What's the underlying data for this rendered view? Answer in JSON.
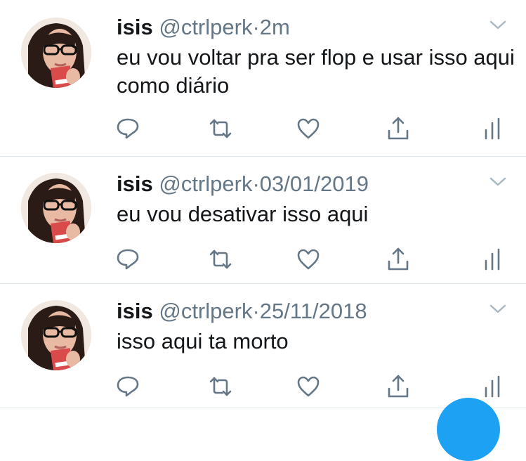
{
  "tweets": [
    {
      "name": "isis",
      "handle": "@ctrlperk",
      "separator": "·",
      "time": "2m",
      "text": "eu vou voltar pra ser flop e usar isso aqui como diário"
    },
    {
      "name": "isis",
      "handle": "@ctrlperk",
      "separator": "·",
      "time": "03/01/2019",
      "text": "eu vou desativar isso aqui"
    },
    {
      "name": "isis",
      "handle": "@ctrlperk",
      "separator": "·",
      "time": "25/11/2018",
      "text": "isso aqui ta morto"
    }
  ],
  "icons": {
    "reply": "reply-icon",
    "retweet": "retweet-icon",
    "like": "heart-icon",
    "share": "share-icon",
    "stats": "analytics-icon",
    "menu": "chevron-down-icon",
    "compose": "compose-button"
  },
  "colors": {
    "text": "#14171a",
    "secondary": "#657786",
    "divider": "#e1e8ed",
    "accent": "#1da1f2"
  }
}
